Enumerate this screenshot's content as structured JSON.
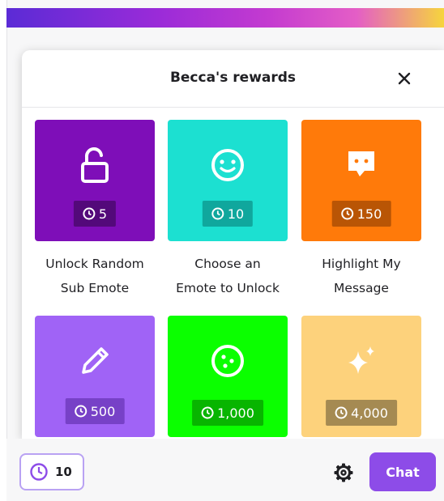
{
  "header": {
    "title": "Becca's rewards"
  },
  "rewards": [
    {
      "label_line1": "Unlock Random",
      "label_line2": "Sub Emote",
      "cost": "5",
      "color": "#7e0eb8",
      "icon": "unlock-icon"
    },
    {
      "label_line1": "Choose an",
      "label_line2": "Emote to Unlock",
      "cost": "10",
      "color": "#1ce0d1",
      "icon": "smiley-icon"
    },
    {
      "label_line1": "Highlight My",
      "label_line2": "Message",
      "cost": "150",
      "color": "#ff7a0a",
      "icon": "message-icon"
    },
    {
      "label_line1": "",
      "label_line2": "",
      "cost": "500",
      "color": "#a063f6",
      "icon": "pencil-icon"
    },
    {
      "label_line1": "",
      "label_line2": "",
      "cost": "1,000",
      "color": "#0bff00",
      "icon": "emote-face-icon"
    },
    {
      "label_line1": "",
      "label_line2": "",
      "cost": "4,000",
      "color": "#fdd27c",
      "icon": "sparkles-icon"
    }
  ],
  "footer": {
    "points": "10",
    "chat_label": "Chat"
  },
  "colors": {
    "accent": "#8d4ce8",
    "pill_border": "#b9a2f3"
  }
}
